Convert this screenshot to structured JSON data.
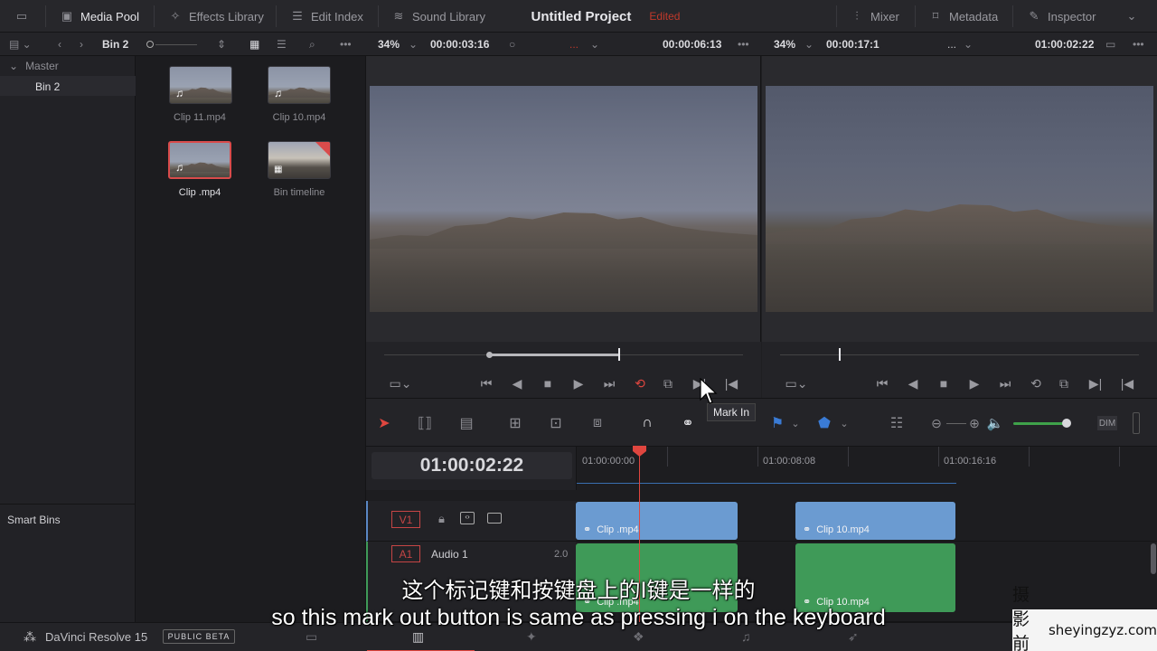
{
  "top": {
    "media_pool": "Media Pool",
    "effects_library": "Effects Library",
    "edit_index": "Edit Index",
    "sound_library": "Sound Library",
    "project_title": "Untitled Project",
    "project_status": "Edited",
    "mixer": "Mixer",
    "metadata": "Metadata",
    "inspector": "Inspector"
  },
  "subbar": {
    "bin_name": "Bin 2",
    "source_zoom": "34%",
    "source_tc": "00:00:03:16",
    "source_duration": "00:00:06:13",
    "source_clip_placeholder": "...",
    "timeline_zoom": "34%",
    "timeline_duration": "00:00:17:1",
    "timeline_dots": "...",
    "timeline_tc": "01:00:02:22"
  },
  "bins_tree": {
    "master": "Master",
    "bin2": "Bin 2",
    "smart_bins": "Smart Bins"
  },
  "media": [
    {
      "label": "Clip 11.mp4",
      "glyph": "♫"
    },
    {
      "label": "Clip 10.mp4",
      "glyph": "♫"
    },
    {
      "label": "Clip .mp4",
      "glyph": "♫"
    },
    {
      "label": "Bin timeline",
      "glyph": "▦"
    }
  ],
  "tooltip": "Mark In",
  "timeline": {
    "timecode": "01:00:02:22",
    "ruler": [
      "01:00:00:00",
      "01:00:08:08",
      "01:00:16:16"
    ],
    "v1": {
      "badge": "V1",
      "clips": [
        "Clip .mp4",
        "Clip 10.mp4"
      ]
    },
    "a1": {
      "badge": "A1",
      "name": "Audio 1",
      "channels": "2.0",
      "clips": [
        "Clip .mp4",
        "Clip 10.mp4"
      ]
    }
  },
  "bottom": {
    "app_name": "DaVinci Resolve 15",
    "beta_badge": "PUBLIC BETA"
  },
  "subtitles": {
    "zh": "这个标记键和按键盘上的I键是一样的",
    "en": "so this mark out button is same as pressing i on the keyboard"
  },
  "watermark": {
    "cn": "摄影前沿",
    "url": "sheyingzyz.com"
  },
  "colors": {
    "accent_red": "#e0463f",
    "video_clip": "#6b9bd1",
    "audio_clip": "#3f9a58"
  }
}
